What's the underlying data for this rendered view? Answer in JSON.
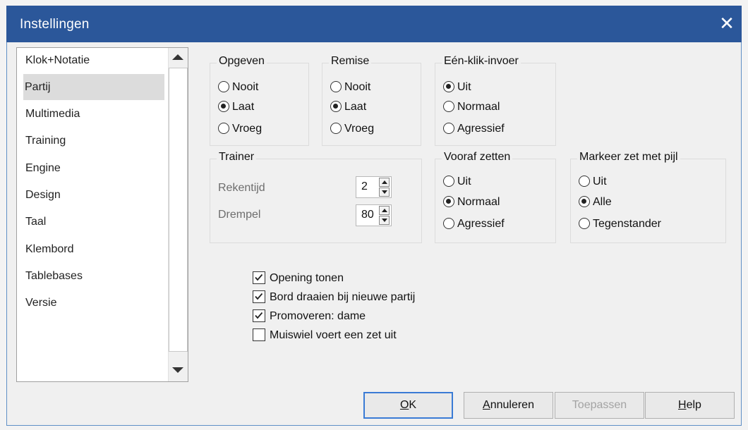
{
  "window": {
    "title": "Instellingen",
    "close_icon": "close-icon"
  },
  "sidebar": {
    "items": [
      {
        "label": "Klok+Notatie"
      },
      {
        "label": "Partij",
        "selected": true
      },
      {
        "label": "Multimedia"
      },
      {
        "label": "Training"
      },
      {
        "label": "Engine"
      },
      {
        "label": "Design"
      },
      {
        "label": "Taal"
      },
      {
        "label": "Klembord"
      },
      {
        "label": "Tablebases"
      },
      {
        "label": "Versie"
      }
    ]
  },
  "groups": {
    "opgeven": {
      "title": "Opgeven",
      "options": [
        {
          "label": "Nooit"
        },
        {
          "label": "Laat",
          "selected": true
        },
        {
          "label": "Vroeg"
        }
      ]
    },
    "remise": {
      "title": "Remise",
      "options": [
        {
          "label": "Nooit"
        },
        {
          "label": "Laat",
          "selected": true
        },
        {
          "label": "Vroeg"
        }
      ]
    },
    "een_klik": {
      "title": "Eén-klik-invoer",
      "options": [
        {
          "label": "Uit",
          "selected": true
        },
        {
          "label": "Normaal"
        },
        {
          "label": "Agressief"
        }
      ]
    },
    "trainer": {
      "title": "Trainer",
      "rekentijd_label": "Rekentijd",
      "rekentijd_value": "2",
      "drempel_label": "Drempel",
      "drempel_value": "80"
    },
    "vooraf": {
      "title": "Vooraf zetten",
      "options": [
        {
          "label": "Uit"
        },
        {
          "label": "Normaal",
          "selected": true
        },
        {
          "label": "Agressief"
        }
      ]
    },
    "markeer": {
      "title": "Markeer zet met pijl",
      "options": [
        {
          "label": "Uit"
        },
        {
          "label": "Alle",
          "selected": true
        },
        {
          "label": "Tegenstander"
        }
      ]
    }
  },
  "checkboxes": [
    {
      "label": "Opening tonen",
      "checked": true
    },
    {
      "label": "Bord draaien bij nieuwe partij",
      "checked": true
    },
    {
      "label": "Promoveren: dame",
      "checked": true
    },
    {
      "label": "Muiswiel voert een zet uit",
      "checked": false
    }
  ],
  "buttons": {
    "ok": {
      "u": "O",
      "rest": "K"
    },
    "annuleren": {
      "u": "A",
      "rest": "nnuleren"
    },
    "toepassen": "Toepassen",
    "help": {
      "u": "H",
      "rest": "elp"
    }
  },
  "colors": {
    "titlebar": "#2b579a",
    "selected_item": "#dcdcdc",
    "primary_border": "#3a7bd5"
  }
}
